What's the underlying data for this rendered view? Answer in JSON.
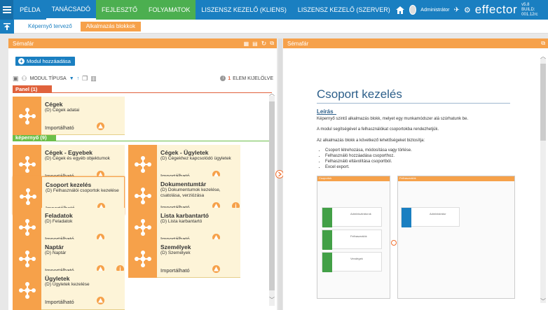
{
  "topnav": {
    "items": [
      "PÉLDA",
      "TANÁCSADÓ",
      "FEJLESZTŐ",
      "FOLYAMATOK",
      "LISZENSZ KEZELŐ (KLIENS)",
      "LISZENSZ KEZELŐ (SZERVER)"
    ],
    "user": "Administrátor",
    "logo": "effector",
    "version": "v5.8",
    "build": "BUILD: 001.12rc"
  },
  "subnav": {
    "items": [
      "Képernyő tervező",
      "Alkalmazás blokkok"
    ]
  },
  "left": {
    "tab": "Sémafár",
    "add_button": "Modul hozzáadása",
    "filter_label": "MODUL TÍPUSA",
    "selected_count": "1",
    "selected_label": "ELEM KIJELÖLVE",
    "sections": [
      {
        "label": "Panel (1)"
      },
      {
        "label": "képernyő (9)"
      }
    ],
    "cards": [
      {
        "title": "Cégek",
        "sub": "(D) Cégek adatai",
        "status": "Importálható"
      },
      {
        "title": "Cégek - Egyebek",
        "sub": "(D) Cégek és egyéb objektumok",
        "status": "Importálható"
      },
      {
        "title": "Cégek - Ügyletek",
        "sub": "(D) Cégekhez kapcsolódó ügyletek",
        "status": "Importálható"
      },
      {
        "title": "Csoport kezelés",
        "sub": "(D) Felhasználói csoportok kezelése",
        "status": "Importálható"
      },
      {
        "title": "Dokumentumtár",
        "sub": "(D) Dokumentumok kezelése, csatolása, verziózása",
        "status": "Importálható"
      },
      {
        "title": "Feladatok",
        "sub": "(D) Feladatok",
        "status": "Importálható"
      },
      {
        "title": "Lista karbantartó",
        "sub": "(D) Lista karbantartó",
        "status": "Importálható"
      },
      {
        "title": "Naptár",
        "sub": "(D) Naptár",
        "status": "Importálható"
      },
      {
        "title": "Személyek",
        "sub": "(D) Személyek",
        "status": "Importálható"
      },
      {
        "title": "Ügyletek",
        "sub": "(D) Ügyletek kezelése",
        "status": "Importálható"
      }
    ]
  },
  "right": {
    "tab": "Sémafár",
    "doc_title": "Csoport kezelés",
    "heading": "Leírás",
    "p1": "Képernyő szintű alkalmazás blokk, melyet egy munkamódszer alá szúrhatunk be.",
    "p2": "A modul segítségével a felhasználókat csoportokba rendezhetjük.",
    "p3": "Az alkalmazás blokk a következő lehetőségeket biztosítja:",
    "bullets": [
      "Csoport létrehozása, módosítása vagy törlése.",
      "Felhasználó hozzáadása csoporthoz.",
      "Felhasználó eltávolítása csoportból.",
      "Excel export."
    ],
    "shot": {
      "left_title": "Csoportok",
      "right_title": "Felhasználók",
      "groups": [
        "Adminisztrátorok",
        "Felhasználók",
        "Vendégek"
      ],
      "member": "Administrátor"
    }
  },
  "colors": {
    "primary": "#1a7fc1",
    "accent": "#f6a14a",
    "panel_red": "#e0623c",
    "screen_green": "#6cbf4a"
  }
}
